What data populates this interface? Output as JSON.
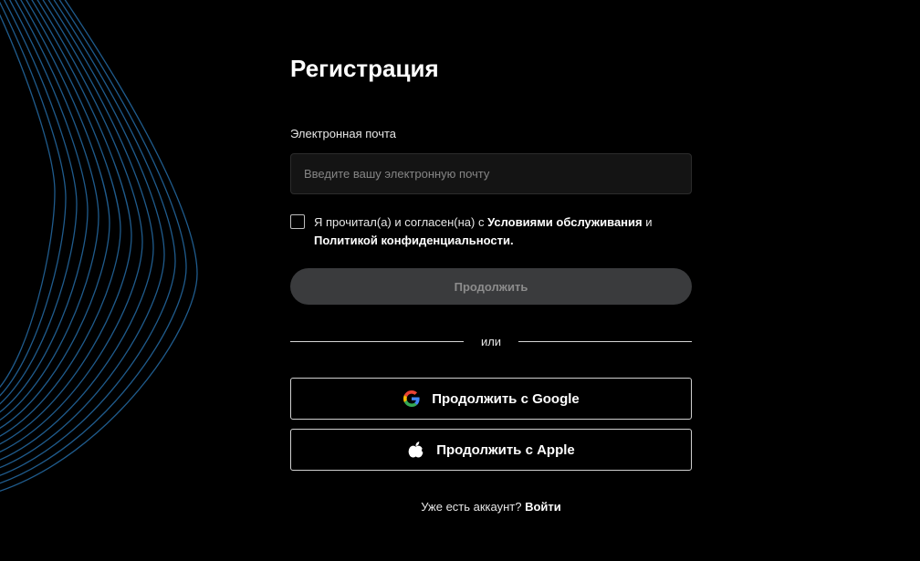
{
  "page": {
    "title": "Регистрация"
  },
  "email": {
    "label": "Электронная почта",
    "placeholder": "Введите вашу электронную почту",
    "value": ""
  },
  "terms": {
    "checked": false,
    "prefix": "Я прочитал(а) и согласен(на) с ",
    "terms_link": "Условиями обслуживания",
    "conjunction": " и ",
    "privacy_link": "Политикой конфиденциальности."
  },
  "continue_button": {
    "label": "Продолжить",
    "state": "disabled"
  },
  "divider": {
    "text": "или"
  },
  "social": {
    "google": {
      "label": "Продолжить с Google",
      "icon": "google-icon"
    },
    "apple": {
      "label": "Продолжить с Apple",
      "icon": "apple-icon"
    }
  },
  "login": {
    "prompt": "Уже есть аккаунт? ",
    "link": "Войти"
  },
  "colors": {
    "background": "#000000",
    "decor_lines": "#1f5b8c",
    "continue_disabled_bg": "#3a3b3d",
    "continue_disabled_text": "#8c8c8c",
    "input_bg": "#141414"
  }
}
